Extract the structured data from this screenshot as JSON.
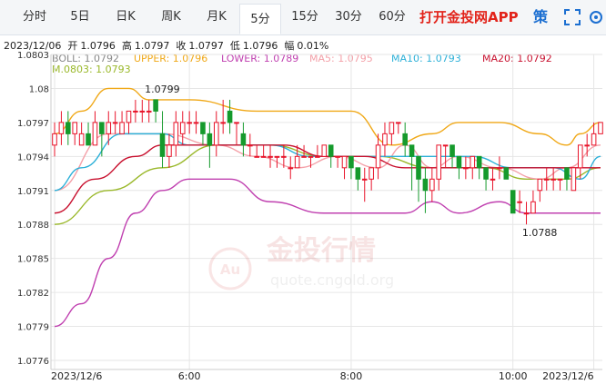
{
  "tabs": [
    {
      "label": "分时",
      "active": false
    },
    {
      "label": "5日",
      "active": false
    },
    {
      "label": "日K",
      "active": false
    },
    {
      "label": "周K",
      "active": false
    },
    {
      "label": "月K",
      "active": false
    },
    {
      "label": "5分",
      "active": true
    },
    {
      "label": "15分",
      "active": false
    },
    {
      "label": "30分",
      "active": false
    },
    {
      "label": "60分",
      "active": false
    }
  ],
  "app_link": "打开金投网APP",
  "strategy_label": "策",
  "info": {
    "date": "2023/12/06",
    "open_label": "开",
    "open": "1.0796",
    "high_label": "高",
    "high": "1.0797",
    "close_label": "收",
    "close": "1.0797",
    "low_label": "低",
    "low": "1.0796",
    "change_label": "幅",
    "change": "0.01%"
  },
  "indicators": {
    "boll": "BOLL: 1.0792",
    "upper": "UPPER: 1.0796",
    "lower": "LOWER: 1.0789",
    "ma5": "MA5: 1.0795",
    "ma10": "MA10: 1.0793",
    "ma20": "MA20: 1.0792",
    "overlap": "M.0803: 1.0793"
  },
  "colors": {
    "upper": "#f0a817",
    "lower": "#c040b0",
    "boll_mid": "#9ab82a",
    "ma5": "#f4a0a8",
    "ma10": "#2cb0d8",
    "ma20": "#c8102e",
    "up_candle": "#e8142a",
    "down_candle": "#159a2c",
    "info_text": "#222222",
    "app_link": "#e2231a"
  },
  "watermark": {
    "brand": "金投行情",
    "logo_text": "Au",
    "url": "quote.cngold.org"
  },
  "chart_data": {
    "type": "candlestick",
    "y_ticks": [
      "1.0803",
      "1.08",
      "1.0797",
      "1.0794",
      "1.0791",
      "1.0788",
      "1.0785",
      "1.0782",
      "1.0779",
      "1.0776"
    ],
    "ylim": [
      1.0776,
      1.0803
    ],
    "x_ticks": [
      "2023/12/6",
      "6:00",
      "8:00",
      "10:00",
      "2023/12/6"
    ],
    "x_tick_index": [
      0,
      20,
      44,
      68,
      80
    ],
    "grid": true,
    "annotations": [
      {
        "text": "1.0799",
        "index": 15,
        "value": 1.07993
      },
      {
        "text": "1.0788",
        "index": 71,
        "value": 1.07881
      }
    ],
    "candles": [
      [
        1.0795,
        1.0796,
        1.0797,
        1.0794
      ],
      [
        1.0796,
        1.0797,
        1.0798,
        1.0795
      ],
      [
        1.0797,
        1.0796,
        1.0798,
        1.0795
      ],
      [
        1.0796,
        1.0797,
        1.0797,
        1.0795
      ],
      [
        1.0795,
        1.0796,
        1.0797,
        1.0795
      ],
      [
        1.0796,
        1.0795,
        1.0797,
        1.0795
      ],
      [
        1.0795,
        1.0797,
        1.0798,
        1.0795
      ],
      [
        1.0797,
        1.0796,
        1.0797,
        1.0794
      ],
      [
        1.0796,
        1.0797,
        1.0798,
        1.0795
      ],
      [
        1.0797,
        1.0797,
        1.0798,
        1.0796
      ],
      [
        1.0796,
        1.0797,
        1.0798,
        1.0796
      ],
      [
        1.0797,
        1.0798,
        1.0798,
        1.0796
      ],
      [
        1.0798,
        1.0798,
        1.0799,
        1.0797
      ],
      [
        1.0798,
        1.0798,
        1.0799,
        1.0797
      ],
      [
        1.0798,
        1.0798,
        1.0799,
        1.0797
      ],
      [
        1.0799,
        1.0798,
        1.0799,
        1.0797
      ],
      [
        1.0796,
        1.0794,
        1.0798,
        1.0793
      ],
      [
        1.0794,
        1.0795,
        1.0796,
        1.0793
      ],
      [
        1.0795,
        1.0797,
        1.0798,
        1.0794
      ],
      [
        1.0796,
        1.0797,
        1.0798,
        1.0795
      ],
      [
        1.0797,
        1.0797,
        1.0798,
        1.0796
      ],
      [
        1.0797,
        1.0797,
        1.0798,
        1.0796
      ],
      [
        1.0797,
        1.0796,
        1.0797,
        1.0795
      ],
      [
        1.0796,
        1.0795,
        1.0797,
        1.0793
      ],
      [
        1.0795,
        1.0797,
        1.0798,
        1.0794
      ],
      [
        1.0797,
        1.0797,
        1.0799,
        1.0796
      ],
      [
        1.0798,
        1.0797,
        1.0799,
        1.0796
      ],
      [
        1.0797,
        1.0797,
        1.0797,
        1.0795
      ],
      [
        1.0796,
        1.0795,
        1.0797,
        1.0794
      ],
      [
        1.0795,
        1.0795,
        1.0796,
        1.0794
      ],
      [
        1.0794,
        1.0794,
        1.0795,
        1.0794
      ],
      [
        1.0794,
        1.0794,
        1.0795,
        1.0794
      ],
      [
        1.0794,
        1.0794,
        1.0795,
        1.0793
      ],
      [
        1.0794,
        1.0794,
        1.0794,
        1.0793
      ],
      [
        1.0794,
        1.0794,
        1.0795,
        1.0793
      ],
      [
        1.0793,
        1.0793,
        1.0794,
        1.0792
      ],
      [
        1.0793,
        1.0794,
        1.0795,
        1.0793
      ],
      [
        1.0794,
        1.0794,
        1.0795,
        1.0794
      ],
      [
        1.0794,
        1.0794,
        1.0794,
        1.0793
      ],
      [
        1.0794,
        1.0794,
        1.0795,
        1.0794
      ],
      [
        1.0794,
        1.0795,
        1.0795,
        1.0794
      ],
      [
        1.0795,
        1.0794,
        1.0795,
        1.0793
      ],
      [
        1.0794,
        1.0794,
        1.0794,
        1.0793
      ],
      [
        1.0793,
        1.0794,
        1.0794,
        1.0792
      ],
      [
        1.0794,
        1.0793,
        1.0794,
        1.0792
      ],
      [
        1.0793,
        1.0792,
        1.0793,
        1.0791
      ],
      [
        1.0792,
        1.0792,
        1.0793,
        1.079
      ],
      [
        1.0792,
        1.0793,
        1.0793,
        1.0791
      ],
      [
        1.0793,
        1.0795,
        1.0796,
        1.0792
      ],
      [
        1.0795,
        1.0796,
        1.0797,
        1.0794
      ],
      [
        1.0796,
        1.0797,
        1.0797,
        1.0795
      ],
      [
        1.0797,
        1.0797,
        1.0797,
        1.0796
      ],
      [
        1.0796,
        1.0795,
        1.0797,
        1.0794
      ],
      [
        1.0795,
        1.0794,
        1.0795,
        1.0791
      ],
      [
        1.0794,
        1.0792,
        1.0794,
        1.079
      ],
      [
        1.0792,
        1.0791,
        1.0793,
        1.0789
      ],
      [
        1.0791,
        1.0792,
        1.0793,
        1.079
      ],
      [
        1.0792,
        1.0795,
        1.0795,
        1.0791
      ],
      [
        1.0795,
        1.0795,
        1.0795,
        1.0793
      ],
      [
        1.0795,
        1.0794,
        1.0795,
        1.0793
      ],
      [
        1.0794,
        1.0793,
        1.0794,
        1.0792
      ],
      [
        1.0793,
        1.0793,
        1.0794,
        1.0792
      ],
      [
        1.0793,
        1.0794,
        1.0794,
        1.0792
      ],
      [
        1.0794,
        1.0793,
        1.0794,
        1.0792
      ],
      [
        1.0793,
        1.0792,
        1.0793,
        1.0791
      ],
      [
        1.0792,
        1.0792,
        1.0793,
        1.0791
      ],
      [
        1.0793,
        1.0793,
        1.0794,
        1.0792
      ],
      [
        1.0793,
        1.0792,
        1.0793,
        1.0792
      ],
      [
        1.0791,
        1.0789,
        1.0791,
        1.0789
      ],
      [
        1.079,
        1.079,
        1.0791,
        1.0789
      ],
      [
        1.0789,
        1.0789,
        1.079,
        1.0788
      ],
      [
        1.0789,
        1.079,
        1.0791,
        1.0789
      ],
      [
        1.0791,
        1.0792,
        1.0792,
        1.079
      ],
      [
        1.0792,
        1.0792,
        1.0793,
        1.0791
      ],
      [
        1.0792,
        1.0792,
        1.0793,
        1.0791
      ],
      [
        1.0792,
        1.0792,
        1.0792,
        1.0791
      ],
      [
        1.0793,
        1.0792,
        1.0793,
        1.0791
      ],
      [
        1.0791,
        1.0793,
        1.0793,
        1.0791
      ],
      [
        1.0793,
        1.0795,
        1.0795,
        1.0792
      ],
      [
        1.0795,
        1.0795,
        1.0796,
        1.0794
      ],
      [
        1.0795,
        1.0796,
        1.0797,
        1.0795
      ],
      [
        1.0796,
        1.0797,
        1.0797,
        1.0796
      ]
    ],
    "series": [
      {
        "name": "UPPER",
        "points": [
          [
            0,
            1.0796
          ],
          [
            4,
            1.0798
          ],
          [
            8,
            1.08
          ],
          [
            11,
            1.08
          ],
          [
            14,
            1.0799
          ],
          [
            20,
            1.0799
          ],
          [
            30,
            1.0798
          ],
          [
            40,
            1.0798
          ],
          [
            44,
            1.0798
          ],
          [
            50,
            1.0795
          ],
          [
            56,
            1.0796
          ],
          [
            60,
            1.0797
          ],
          [
            66,
            1.0797
          ],
          [
            72,
            1.0796
          ],
          [
            76,
            1.0795
          ],
          [
            78,
            1.0796
          ],
          [
            81,
            1.0797
          ]
        ]
      },
      {
        "name": "BOLL",
        "points": [
          [
            0,
            1.0788
          ],
          [
            8,
            1.0791
          ],
          [
            16,
            1.0793
          ],
          [
            24,
            1.0795
          ],
          [
            32,
            1.0795
          ],
          [
            40,
            1.0794
          ],
          [
            48,
            1.0794
          ],
          [
            56,
            1.0793
          ],
          [
            64,
            1.0793
          ],
          [
            70,
            1.0792
          ],
          [
            76,
            1.0792
          ],
          [
            81,
            1.0793
          ]
        ]
      },
      {
        "name": "LOWER",
        "points": [
          [
            0,
            1.0779
          ],
          [
            4,
            1.0781
          ],
          [
            8,
            1.0785
          ],
          [
            12,
            1.0789
          ],
          [
            16,
            1.0791
          ],
          [
            20,
            1.0792
          ],
          [
            26,
            1.0792
          ],
          [
            32,
            1.079
          ],
          [
            40,
            1.0789
          ],
          [
            48,
            1.0789
          ],
          [
            52,
            1.0789
          ],
          [
            56,
            1.079
          ],
          [
            60,
            1.0789
          ],
          [
            66,
            1.079
          ],
          [
            70,
            1.0789
          ],
          [
            74,
            1.0789
          ],
          [
            78,
            1.0789
          ],
          [
            81,
            1.0789
          ]
        ]
      },
      {
        "name": "MA5",
        "points": [
          [
            0,
            1.0791
          ],
          [
            8,
            1.0796
          ],
          [
            16,
            1.0796
          ],
          [
            24,
            1.0795
          ],
          [
            30,
            1.0794
          ],
          [
            36,
            1.0793
          ],
          [
            42,
            1.0794
          ],
          [
            48,
            1.0793
          ],
          [
            52,
            1.0795
          ],
          [
            56,
            1.0793
          ],
          [
            60,
            1.0794
          ],
          [
            66,
            1.0793
          ],
          [
            72,
            1.0792
          ],
          [
            76,
            1.0793
          ],
          [
            81,
            1.0795
          ]
        ]
      },
      {
        "name": "MA10",
        "points": [
          [
            0,
            1.0791
          ],
          [
            4,
            1.0793
          ],
          [
            10,
            1.0796
          ],
          [
            16,
            1.0796
          ],
          [
            20,
            1.0795
          ],
          [
            26,
            1.0795
          ],
          [
            32,
            1.0795
          ],
          [
            38,
            1.0794
          ],
          [
            44,
            1.0794
          ],
          [
            50,
            1.0794
          ],
          [
            56,
            1.0794
          ],
          [
            62,
            1.0794
          ],
          [
            68,
            1.0793
          ],
          [
            74,
            1.0793
          ],
          [
            78,
            1.0792
          ],
          [
            81,
            1.0794
          ]
        ]
      },
      {
        "name": "MA20",
        "points": [
          [
            0,
            1.0789
          ],
          [
            6,
            1.0792
          ],
          [
            12,
            1.0794
          ],
          [
            16,
            1.0795
          ],
          [
            22,
            1.0795
          ],
          [
            28,
            1.0795
          ],
          [
            34,
            1.0795
          ],
          [
            40,
            1.0794
          ],
          [
            46,
            1.0794
          ],
          [
            52,
            1.0793
          ],
          [
            58,
            1.0793
          ],
          [
            64,
            1.0793
          ],
          [
            70,
            1.0793
          ],
          [
            76,
            1.0793
          ],
          [
            81,
            1.0793
          ]
        ]
      }
    ]
  }
}
